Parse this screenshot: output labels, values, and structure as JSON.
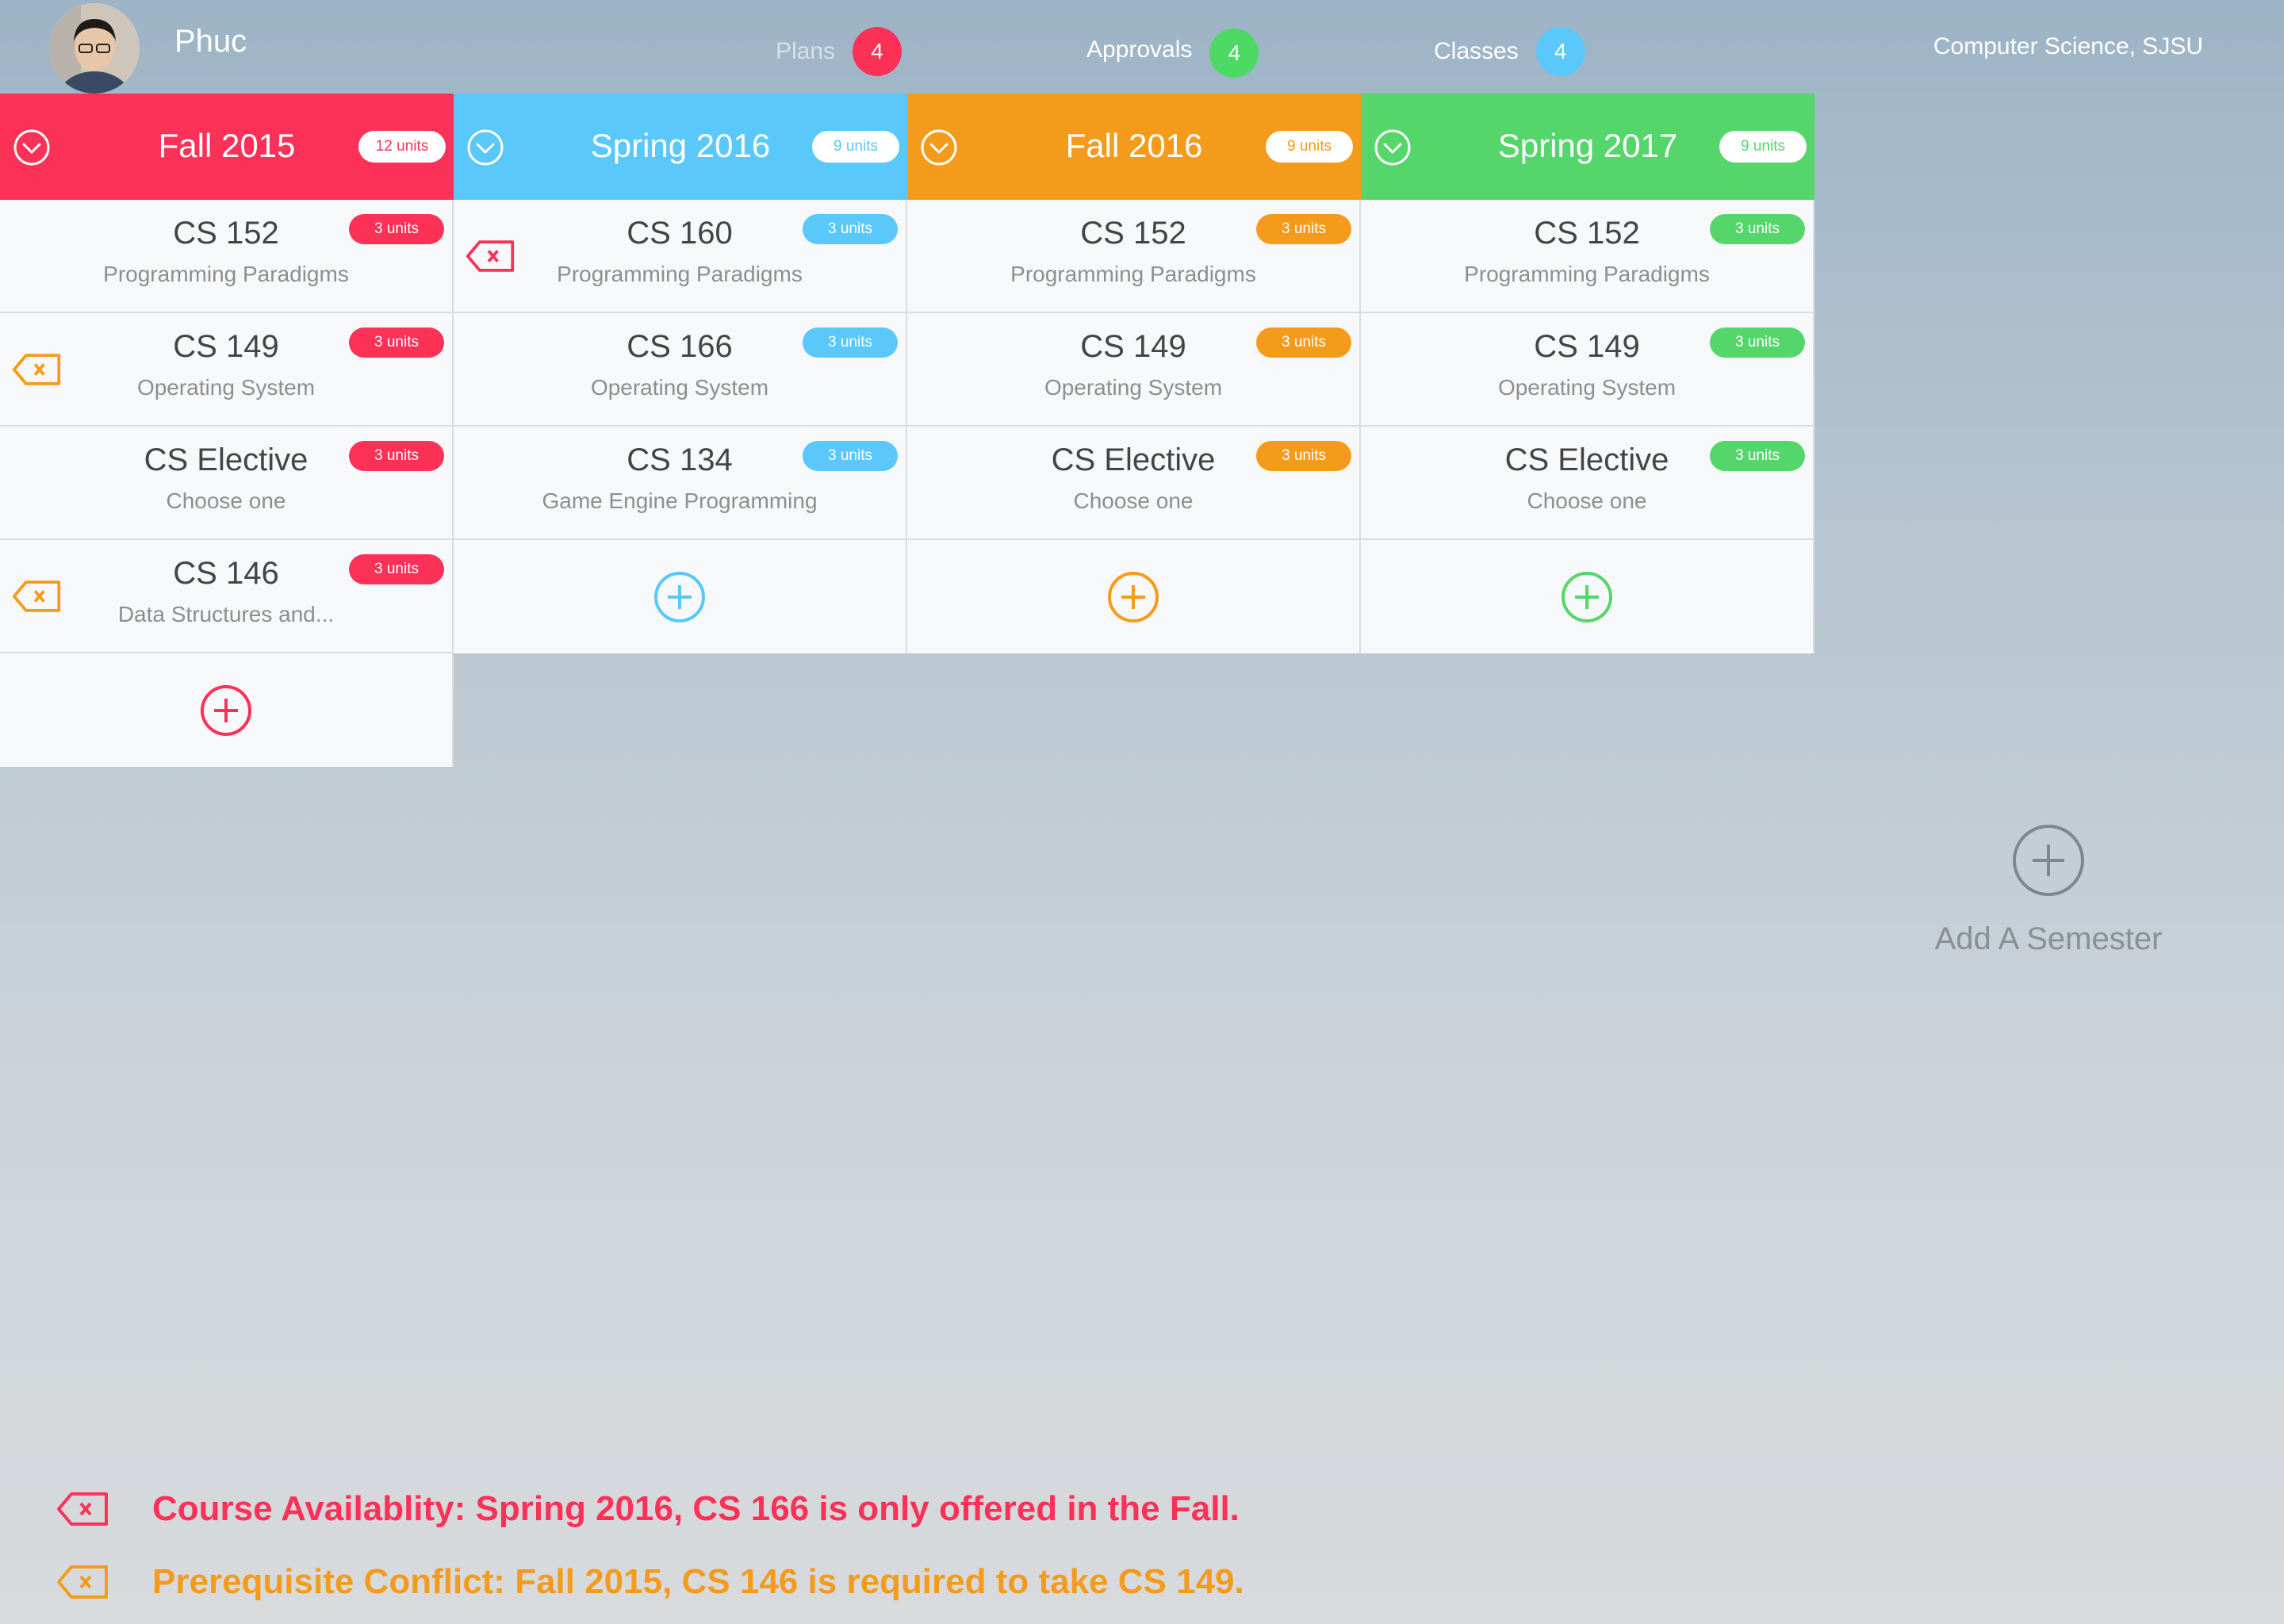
{
  "user": {
    "name": "Phuc"
  },
  "nav": [
    {
      "label": "Plans",
      "count": "4",
      "color": "#fc3158"
    },
    {
      "label": "Approvals",
      "count": "4",
      "color": "#4cd964"
    },
    {
      "label": "Classes",
      "count": "4",
      "color": "#5ac8fa"
    }
  ],
  "department": "Computer Science, SJSU",
  "semesters": [
    {
      "name": "Fall 2015",
      "units": "12 units",
      "color": "#fc3158",
      "courses": [
        {
          "code": "CS 152",
          "title": "Programming Paradigms",
          "units": "3 units",
          "warning": null
        },
        {
          "code": "CS 149",
          "title": "Operating System",
          "units": "3 units",
          "warning": "prerequisite"
        },
        {
          "code": "CS Elective",
          "title": "Choose one",
          "units": "3 units",
          "warning": null
        },
        {
          "code": "CS 146",
          "title": "Data Structures and...",
          "units": "3 units",
          "warning": "prerequisite"
        }
      ]
    },
    {
      "name": "Spring 2016",
      "units": "9 units",
      "color": "#5ac8fa",
      "courses": [
        {
          "code": "CS 160",
          "title": "Programming Paradigms",
          "units": "3 units",
          "warning": "availability"
        },
        {
          "code": "CS 166",
          "title": "Operating System",
          "units": "3 units",
          "warning": null
        },
        {
          "code": "CS 134",
          "title": "Game Engine Programming",
          "units": "3 units",
          "warning": null
        }
      ]
    },
    {
      "name": "Fall 2016",
      "units": "9 units",
      "color": "#f59b1c",
      "courses": [
        {
          "code": "CS 152",
          "title": "Programming Paradigms",
          "units": "3 units",
          "warning": null
        },
        {
          "code": "CS 149",
          "title": "Operating System",
          "units": "3 units",
          "warning": null
        },
        {
          "code": "CS Elective",
          "title": "Choose one",
          "units": "3 units",
          "warning": null
        }
      ]
    },
    {
      "name": "Spring 2017",
      "units": "9 units",
      "color": "#55d66b",
      "courses": [
        {
          "code": "CS 152",
          "title": "Programming Paradigms",
          "units": "3 units",
          "warning": null
        },
        {
          "code": "CS 149",
          "title": "Operating System",
          "units": "3 units",
          "warning": null
        },
        {
          "code": "CS Elective",
          "title": "Choose one",
          "units": "3 units",
          "warning": null
        }
      ]
    }
  ],
  "add_semester": {
    "label": "Add A Semester"
  },
  "alerts": [
    {
      "type": "availability",
      "color": "#fc3158",
      "text": "Course Availablity: Spring 2016, CS 166 is only offered in the Fall."
    },
    {
      "type": "prerequisite",
      "color": "#f59b1c",
      "text": "Prerequisite Conflict: Fall 2015, CS 146 is required to take CS 149."
    }
  ],
  "icons": {
    "collapse": "chevron-down-circle-icon",
    "add": "plus-circle-icon",
    "warning": "delete-tag-icon"
  }
}
